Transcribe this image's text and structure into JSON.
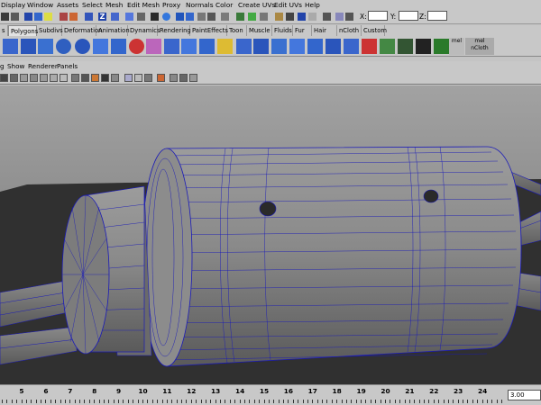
{
  "menubar": {
    "items": [
      "Display",
      "Window",
      "Assets",
      "Select",
      "Mesh",
      "Edit Mesh",
      "Proxy",
      "Normals",
      "Color",
      "Create UVs",
      "Edit UVs",
      "Help"
    ]
  },
  "statusline": {
    "x_label": "X:",
    "y_label": "Y:",
    "z_label": "Z:",
    "x_value": "",
    "y_value": "",
    "z_value": ""
  },
  "shelf_tabs": {
    "items": [
      "s",
      "Polygons",
      "Subdivs",
      "Deformation",
      "Animation",
      "Dynamics",
      "Rendering",
      "PaintEffects",
      "Toon",
      "Muscle",
      "Fluids",
      "Fur",
      "Hair",
      "nCloth",
      "Custom"
    ],
    "active": "Polygons"
  },
  "shelf": {
    "mel_label_1": "mel",
    "mel_label_2": "mel",
    "ncloth_label": "nCloth"
  },
  "panel_menu": {
    "items": [
      "g",
      "Show",
      "Renderer",
      "Panels"
    ]
  },
  "timeline": {
    "labels": [
      "5",
      "6",
      "7",
      "8",
      "9",
      "10",
      "11",
      "12",
      "13",
      "14",
      "15",
      "16",
      "17",
      "18",
      "19",
      "20",
      "21",
      "22",
      "23",
      "24"
    ],
    "current_frame": "3.00"
  },
  "colors": {
    "viewport_bg": "#8e8e8e",
    "wireframe": "#1a1ab8",
    "mesh_gray": "#8a8a8a",
    "ground": "#303030"
  }
}
